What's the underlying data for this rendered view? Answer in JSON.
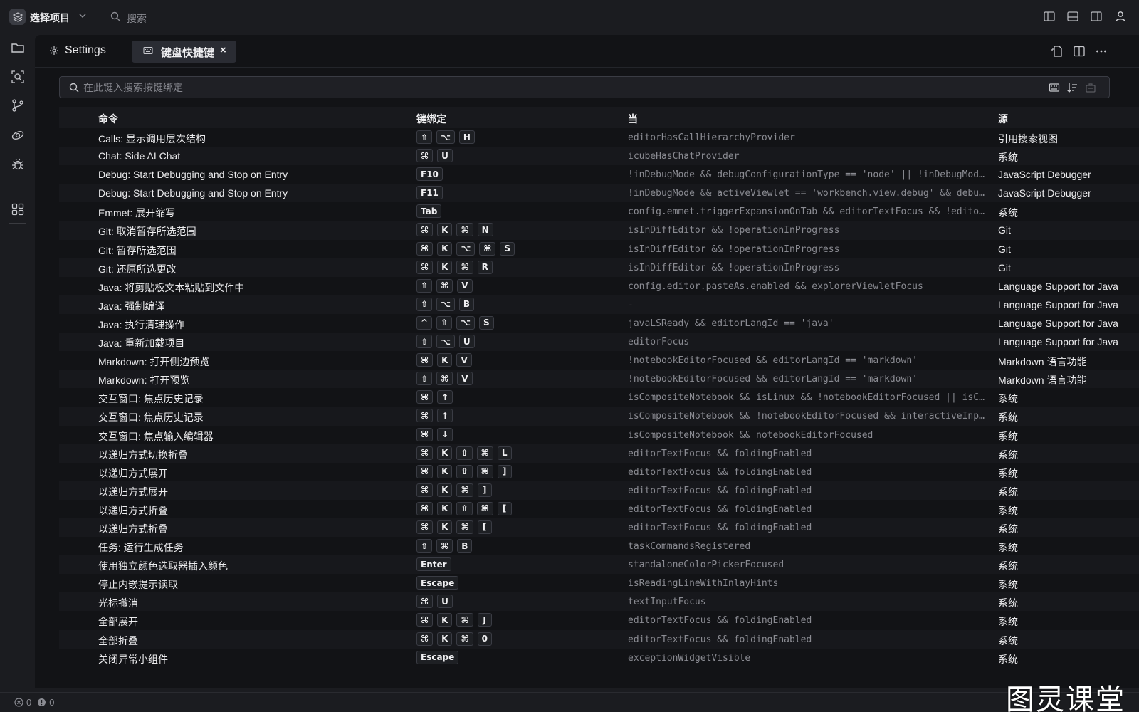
{
  "titlebar": {
    "project_label": "选择项目",
    "search_placeholder": "搜索"
  },
  "tabs": {
    "settings_label": "Settings",
    "active_label": "键盘快捷键",
    "close_glyph": "×"
  },
  "search": {
    "placeholder": "在此键入搜索按键绑定"
  },
  "table": {
    "headers": {
      "command": "命令",
      "keybinding": "键绑定",
      "when": "当",
      "source": "源"
    },
    "rows": [
      {
        "command": "Calls: 显示调用层次结构",
        "keys": [
          "⇧",
          "⌥",
          "H"
        ],
        "when": "editorHasCallHierarchyProvider",
        "source": "引用搜索视图"
      },
      {
        "command": "Chat: Side AI Chat",
        "keys": [
          "⌘",
          "U"
        ],
        "when": "icubeHasChatProvider",
        "source": "系统"
      },
      {
        "command": "Debug: Start Debugging and Stop on Entry",
        "keys": [
          "F10"
        ],
        "when": "!inDebugMode && debugConfigurationType == 'node' || !inDebugMode && debugC…",
        "source": "JavaScript Debugger"
      },
      {
        "command": "Debug: Start Debugging and Stop on Entry",
        "keys": [
          "F11"
        ],
        "when": "!inDebugMode && activeViewlet == 'workbench.view.debug' && debugC…",
        "source": "JavaScript Debugger"
      },
      {
        "command": "Emmet: 展开缩写",
        "keys": [
          "Tab"
        ],
        "when": "config.emmet.triggerExpansionOnTab && editorTextFocus && !editorR…",
        "source": "系统"
      },
      {
        "command": "Git: 取消暂存所选范围",
        "keys": [
          "⌘",
          "K",
          "⌘",
          "N"
        ],
        "when": "isInDiffEditor && !operationInProgress",
        "source": "Git"
      },
      {
        "command": "Git: 暂存所选范围",
        "keys": [
          "⌘",
          "K",
          "⌥",
          "⌘",
          "S"
        ],
        "when": "isInDiffEditor && !operationInProgress",
        "source": "Git"
      },
      {
        "command": "Git: 还原所选更改",
        "keys": [
          "⌘",
          "K",
          "⌘",
          "R"
        ],
        "when": "isInDiffEditor && !operationInProgress",
        "source": "Git"
      },
      {
        "command": "Java: 将剪贴板文本粘贴到文件中",
        "keys": [
          "⇧",
          "⌘",
          "V"
        ],
        "when": "config.editor.pasteAs.enabled && explorerViewletFocus",
        "source": "Language Support for Java"
      },
      {
        "command": "Java: 强制编译",
        "keys": [
          "⇧",
          "⌥",
          "B"
        ],
        "when": "-",
        "source": "Language Support for Java"
      },
      {
        "command": "Java: 执行清理操作",
        "keys": [
          "^",
          "⇧",
          "⌥",
          "S"
        ],
        "when": "javaLSReady && editorLangId == 'java'",
        "source": "Language Support for Java"
      },
      {
        "command": "Java: 重新加载项目",
        "keys": [
          "⇧",
          "⌥",
          "U"
        ],
        "when": "editorFocus",
        "source": "Language Support for Java"
      },
      {
        "command": "Markdown: 打开侧边预览",
        "keys": [
          "⌘",
          "K",
          "V"
        ],
        "when": "!notebookEditorFocused && editorLangId == 'markdown'",
        "source": "Markdown 语言功能"
      },
      {
        "command": "Markdown: 打开预览",
        "keys": [
          "⇧",
          "⌘",
          "V"
        ],
        "when": "!notebookEditorFocused && editorLangId == 'markdown'",
        "source": "Markdown 语言功能"
      },
      {
        "command": "交互窗口: 焦点历史记录",
        "keys": [
          "⌘",
          "↑"
        ],
        "when": "isCompositeNotebook && isLinux && !notebookEditorFocused || isCom…",
        "source": "系统"
      },
      {
        "command": "交互窗口: 焦点历史记录",
        "keys": [
          "⌘",
          "↑"
        ],
        "when": "isCompositeNotebook && !notebookEditorFocused && interactiveInput…",
        "source": "系统"
      },
      {
        "command": "交互窗口: 焦点输入编辑器",
        "keys": [
          "⌘",
          "↓"
        ],
        "when": "isCompositeNotebook && notebookEditorFocused",
        "source": "系统"
      },
      {
        "command": "以递归方式切换折叠",
        "keys": [
          "⌘",
          "K",
          "⇧",
          "⌘",
          "L"
        ],
        "when": "editorTextFocus && foldingEnabled",
        "source": "系统"
      },
      {
        "command": "以递归方式展开",
        "keys": [
          "⌘",
          "K",
          "⇧",
          "⌘",
          "]"
        ],
        "when": "editorTextFocus && foldingEnabled",
        "source": "系统"
      },
      {
        "command": "以递归方式展开",
        "keys": [
          "⌘",
          "K",
          "⌘",
          "]"
        ],
        "when": "editorTextFocus && foldingEnabled",
        "source": "系统"
      },
      {
        "command": "以递归方式折叠",
        "keys": [
          "⌘",
          "K",
          "⇧",
          "⌘",
          "["
        ],
        "when": "editorTextFocus && foldingEnabled",
        "source": "系统"
      },
      {
        "command": "以递归方式折叠",
        "keys": [
          "⌘",
          "K",
          "⌘",
          "["
        ],
        "when": "editorTextFocus && foldingEnabled",
        "source": "系统"
      },
      {
        "command": "任务: 运行生成任务",
        "keys": [
          "⇧",
          "⌘",
          "B"
        ],
        "when": "taskCommandsRegistered",
        "source": "系统"
      },
      {
        "command": "使用独立颜色选取器插入颜色",
        "keys": [
          "Enter"
        ],
        "when": "standaloneColorPickerFocused",
        "source": "系统"
      },
      {
        "command": "停止内嵌提示读取",
        "keys": [
          "Escape"
        ],
        "when": "isReadingLineWithInlayHints",
        "source": "系统"
      },
      {
        "command": "光标撤消",
        "keys": [
          "⌘",
          "U"
        ],
        "when": "textInputFocus",
        "source": "系统"
      },
      {
        "command": "全部展开",
        "keys": [
          "⌘",
          "K",
          "⌘",
          "J"
        ],
        "when": "editorTextFocus && foldingEnabled",
        "source": "系统"
      },
      {
        "command": "全部折叠",
        "keys": [
          "⌘",
          "K",
          "⌘",
          "0"
        ],
        "when": "editorTextFocus && foldingEnabled",
        "source": "系统"
      },
      {
        "command": "关闭异常小组件",
        "keys": [
          "Escape"
        ],
        "when": "exceptionWidgetVisible",
        "source": "系统"
      }
    ]
  },
  "statusbar": {
    "errors": "0",
    "warnings": "0"
  },
  "watermark": "图灵课堂",
  "colors": {
    "background": "#1b1c20",
    "panel": "#121316",
    "active_tab": "#2a2c33",
    "muted_text": "#8a8b92"
  }
}
